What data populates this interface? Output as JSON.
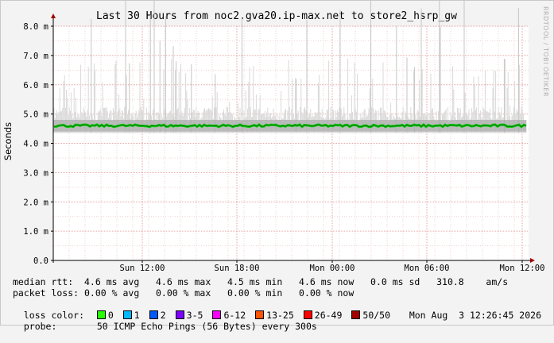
{
  "chart_data": {
    "type": "line",
    "title": "Last 30 Hours from noc2.gva20.ip-max.net to store2_hsrp_gw",
    "ylabel": "Seconds",
    "xlabel": "",
    "ylim": [
      0,
      8.0
    ],
    "yticks": [
      "0.0",
      "1.0 m",
      "2.0 m",
      "3.0 m",
      "4.0 m",
      "5.0 m",
      "6.0 m",
      "7.0 m",
      "8.0 m"
    ],
    "xticks": [
      "Sun 12:00",
      "Sun 18:00",
      "Mon 00:00",
      "Mon 06:00",
      "Mon 12:00"
    ],
    "grid": true,
    "series": [
      {
        "name": "median rtt",
        "unit": "ms",
        "value_approx": 4.6,
        "color": "#00cc00"
      }
    ]
  },
  "watermark": "RRDTOOL / TOBI OETIKER",
  "stats": {
    "line1": "median rtt:  4.6 ms avg   4.6 ms max   4.5 ms min   4.6 ms now   0.0 ms sd   310.8    am/s",
    "line2": "packet loss: 0.00 % avg   0.00 % max   0.00 % min   0.00 % now"
  },
  "loss_color": {
    "label": "loss color:",
    "items": [
      {
        "label": "0",
        "color": "#26ff00"
      },
      {
        "label": "1",
        "color": "#00b8ff"
      },
      {
        "label": "2",
        "color": "#0059ff"
      },
      {
        "label": "3-5",
        "color": "#7e00ff"
      },
      {
        "label": "6-12",
        "color": "#ff00ff"
      },
      {
        "label": "13-25",
        "color": "#ff5500"
      },
      {
        "label": "26-49",
        "color": "#ff0000"
      },
      {
        "label": "50/50",
        "color": "#a10000"
      }
    ]
  },
  "probe": {
    "label": "probe:",
    "text": "50 ICMP Echo Pings (56 Bytes) every 300s",
    "timestamp": "Mon Aug  3 12:26:45 2026"
  }
}
